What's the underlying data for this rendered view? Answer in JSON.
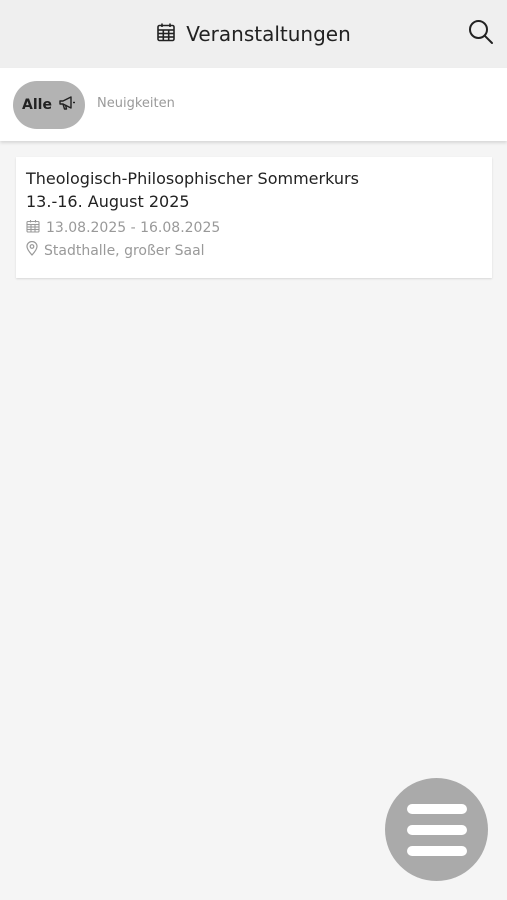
{
  "header": {
    "title": "Veranstaltungen",
    "title_icon": "calendar-icon",
    "search_icon": "search-icon"
  },
  "filters": {
    "active": {
      "label": "Alle",
      "icon": "megaphone-icon"
    },
    "inactive": {
      "label": "Neuigkeiten"
    }
  },
  "events": [
    {
      "title_line1": "Theologisch-Philosophischer Sommerkurs",
      "title_line2": "13.-16. August 2025",
      "date_range": "13.08.2025 - 16.08.2025",
      "location": "Stadthalle, großer Saal"
    }
  ],
  "menu_button": {
    "icon": "menu-icon"
  },
  "colors": {
    "header_bg": "#efefef",
    "background": "#f5f5f5",
    "chip_active": "#b3b3b3",
    "fab": "#aaaaaa",
    "muted_text": "#999999"
  }
}
